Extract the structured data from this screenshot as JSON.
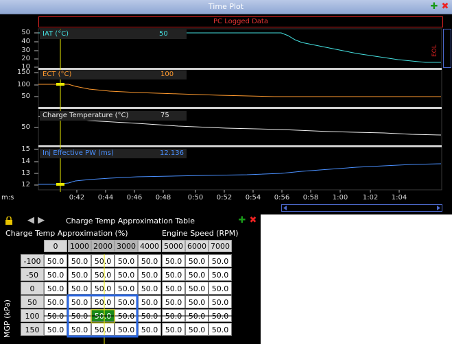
{
  "time_plot": {
    "title": "Time Plot",
    "banner": "PC Logged Data",
    "eol": "EOL",
    "x_axis_unit": "m:s",
    "x_ticks": [
      "0:42",
      "0:44",
      "0:46",
      "0:48",
      "0:50",
      "0:52",
      "0:54",
      "0:56",
      "0:58",
      "1:00",
      "1:02",
      "1:04"
    ],
    "channels": [
      {
        "label": "IAT (°C)",
        "value": "50",
        "color": "#45e0e0",
        "y_ticks": [
          "50",
          "40",
          "30",
          "20",
          "10"
        ]
      },
      {
        "label": "ECT (°C)",
        "value": "100",
        "color": "#ff9a2e",
        "y_ticks": [
          "150",
          "100",
          "50"
        ]
      },
      {
        "label": "Charge Temperature (°C)",
        "value": "75",
        "color": "#f0f0f0",
        "y_ticks": [
          "50"
        ]
      },
      {
        "label": "Inj Effective PW (ms)",
        "value": "12.136",
        "color": "#4a90ff",
        "y_ticks": [
          "15",
          "14",
          "13",
          "12"
        ]
      }
    ]
  },
  "table": {
    "title": "Charge Temp Approximation Table",
    "subtitle": "Charge Temp Approximation (%)",
    "x_axis_label": "Engine Speed (RPM)",
    "y_axis_label": "MGP (kPa)",
    "columns": [
      "0",
      "1000",
      "2000",
      "3000",
      "4000",
      "5000",
      "6000",
      "7000"
    ],
    "rows": [
      "-100",
      "-50",
      "0",
      "50",
      "100",
      "150"
    ],
    "cells": [
      [
        "50.0",
        "50.0",
        "50.0",
        "50.0",
        "50.0",
        "50.0",
        "50.0",
        "50.0"
      ],
      [
        "50.0",
        "50.0",
        "50.0",
        "50.0",
        "50.0",
        "50.0",
        "50.0",
        "50.0"
      ],
      [
        "50.0",
        "50.0",
        "50.0",
        "50.0",
        "50.0",
        "50.0",
        "50.0",
        "50.0"
      ],
      [
        "50.0",
        "50.0",
        "50.0",
        "50.0",
        "50.0",
        "50.0",
        "50.0",
        "50.0"
      ],
      [
        "50.0",
        "50.0",
        "50.0",
        "50.0",
        "50.0",
        "50.0",
        "50.0",
        "50.0"
      ],
      [
        "50.0",
        "50.0",
        "50.0",
        "50.0",
        "50.0",
        "50.0",
        "50.0",
        "50.0"
      ]
    ],
    "selected_cell": {
      "row": 4,
      "col": 2
    },
    "colors": {
      "highlight": "#2a66e0",
      "selected": "#1a8a1a",
      "cursor": "#e8e800"
    }
  },
  "icons": [
    "add-icon",
    "close-icon",
    "lock-icon",
    "back-arrow-icon",
    "forward-arrow-icon"
  ]
}
